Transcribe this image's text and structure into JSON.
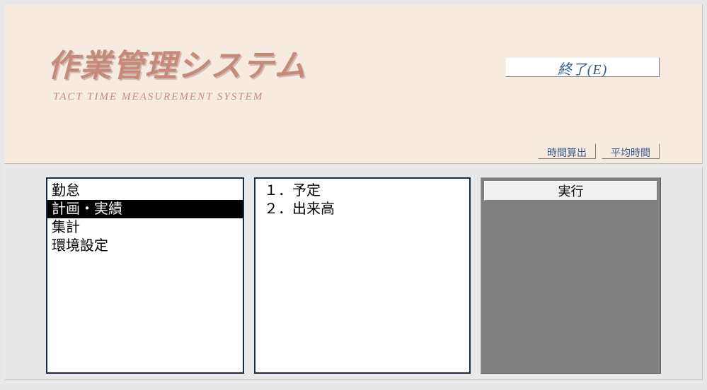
{
  "header": {
    "title": "作業管理システム",
    "subtitle": "TACT TIME  MEASUREMENT  SYSTEM",
    "exit_label": "終了(E)",
    "time_calc_label": "時間算出",
    "avg_time_label": "平均時間"
  },
  "main_list": {
    "items": [
      {
        "label": "勤怠",
        "selected": false
      },
      {
        "label": "計画・実績",
        "selected": true
      },
      {
        "label": "集計",
        "selected": false
      },
      {
        "label": "環境設定",
        "selected": false
      }
    ]
  },
  "sub_list": {
    "items": [
      {
        "label": "１．予定"
      },
      {
        "label": "２．出来高"
      }
    ]
  },
  "action": {
    "execute_label": "実行"
  }
}
